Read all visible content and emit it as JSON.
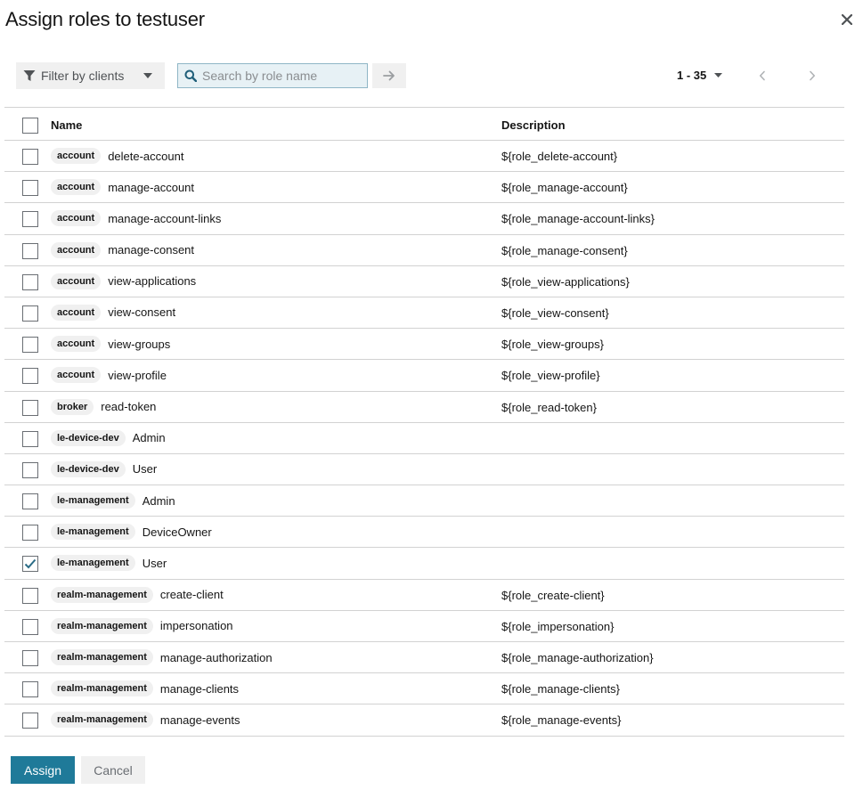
{
  "modal": {
    "title": "Assign roles to testuser",
    "close_icon": "close-icon"
  },
  "toolbar": {
    "filter_label": "Filter by clients",
    "filter_icon": "filter-icon",
    "search_placeholder": "Search by role name",
    "search_value": "",
    "pagination_range": "1 - 35"
  },
  "table": {
    "columns": {
      "name": "Name",
      "description": "Description"
    },
    "rows": [
      {
        "client": "account",
        "role": "delete-account",
        "description": "${role_delete-account}",
        "checked": false
      },
      {
        "client": "account",
        "role": "manage-account",
        "description": "${role_manage-account}",
        "checked": false
      },
      {
        "client": "account",
        "role": "manage-account-links",
        "description": "${role_manage-account-links}",
        "checked": false
      },
      {
        "client": "account",
        "role": "manage-consent",
        "description": "${role_manage-consent}",
        "checked": false
      },
      {
        "client": "account",
        "role": "view-applications",
        "description": "${role_view-applications}",
        "checked": false
      },
      {
        "client": "account",
        "role": "view-consent",
        "description": "${role_view-consent}",
        "checked": false
      },
      {
        "client": "account",
        "role": "view-groups",
        "description": "${role_view-groups}",
        "checked": false
      },
      {
        "client": "account",
        "role": "view-profile",
        "description": "${role_view-profile}",
        "checked": false
      },
      {
        "client": "broker",
        "role": "read-token",
        "description": "${role_read-token}",
        "checked": false
      },
      {
        "client": "le-device-dev",
        "role": "Admin",
        "description": "",
        "checked": false
      },
      {
        "client": "le-device-dev",
        "role": "User",
        "description": "",
        "checked": false
      },
      {
        "client": "le-management",
        "role": "Admin",
        "description": "",
        "checked": false
      },
      {
        "client": "le-management",
        "role": "DeviceOwner",
        "description": "",
        "checked": false
      },
      {
        "client": "le-management",
        "role": "User",
        "description": "",
        "checked": true
      },
      {
        "client": "realm-management",
        "role": "create-client",
        "description": "${role_create-client}",
        "checked": false
      },
      {
        "client": "realm-management",
        "role": "impersonation",
        "description": "${role_impersonation}",
        "checked": false
      },
      {
        "client": "realm-management",
        "role": "manage-authorization",
        "description": "${role_manage-authorization}",
        "checked": false
      },
      {
        "client": "realm-management",
        "role": "manage-clients",
        "description": "${role_manage-clients}",
        "checked": false
      },
      {
        "client": "realm-management",
        "role": "manage-events",
        "description": "${role_manage-events}",
        "checked": false
      }
    ]
  },
  "footer": {
    "assign_label": "Assign",
    "cancel_label": "Cancel"
  },
  "colors": {
    "primary": "#1f7a99",
    "checkmark": "#2b6c86",
    "border": "#d2d2d2",
    "badge_bg": "#f0f0f0"
  }
}
